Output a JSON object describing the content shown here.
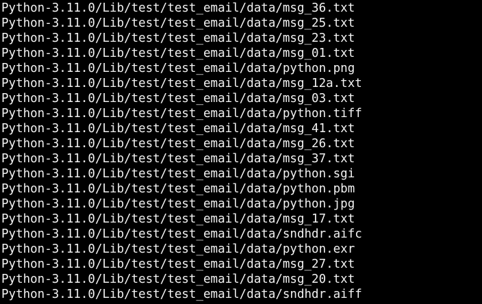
{
  "terminal": {
    "background": "#000000",
    "foreground": "#f2f2f2",
    "lines": [
      "Python-3.11.0/Lib/test/test_email/data/msg_36.txt",
      "Python-3.11.0/Lib/test/test_email/data/msg_25.txt",
      "Python-3.11.0/Lib/test/test_email/data/msg_23.txt",
      "Python-3.11.0/Lib/test/test_email/data/msg_01.txt",
      "Python-3.11.0/Lib/test/test_email/data/python.png",
      "Python-3.11.0/Lib/test/test_email/data/msg_12a.txt",
      "Python-3.11.0/Lib/test/test_email/data/msg_03.txt",
      "Python-3.11.0/Lib/test/test_email/data/python.tiff",
      "Python-3.11.0/Lib/test/test_email/data/msg_41.txt",
      "Python-3.11.0/Lib/test/test_email/data/msg_26.txt",
      "Python-3.11.0/Lib/test/test_email/data/msg_37.txt",
      "Python-3.11.0/Lib/test/test_email/data/python.sgi",
      "Python-3.11.0/Lib/test/test_email/data/python.pbm",
      "Python-3.11.0/Lib/test/test_email/data/python.jpg",
      "Python-3.11.0/Lib/test/test_email/data/msg_17.txt",
      "Python-3.11.0/Lib/test/test_email/data/sndhdr.aifc",
      "Python-3.11.0/Lib/test/test_email/data/python.exr",
      "Python-3.11.0/Lib/test/test_email/data/msg_27.txt",
      "Python-3.11.0/Lib/test/test_email/data/msg_20.txt",
      "Python-3.11.0/Lib/test/test_email/data/sndhdr.aiff"
    ]
  }
}
